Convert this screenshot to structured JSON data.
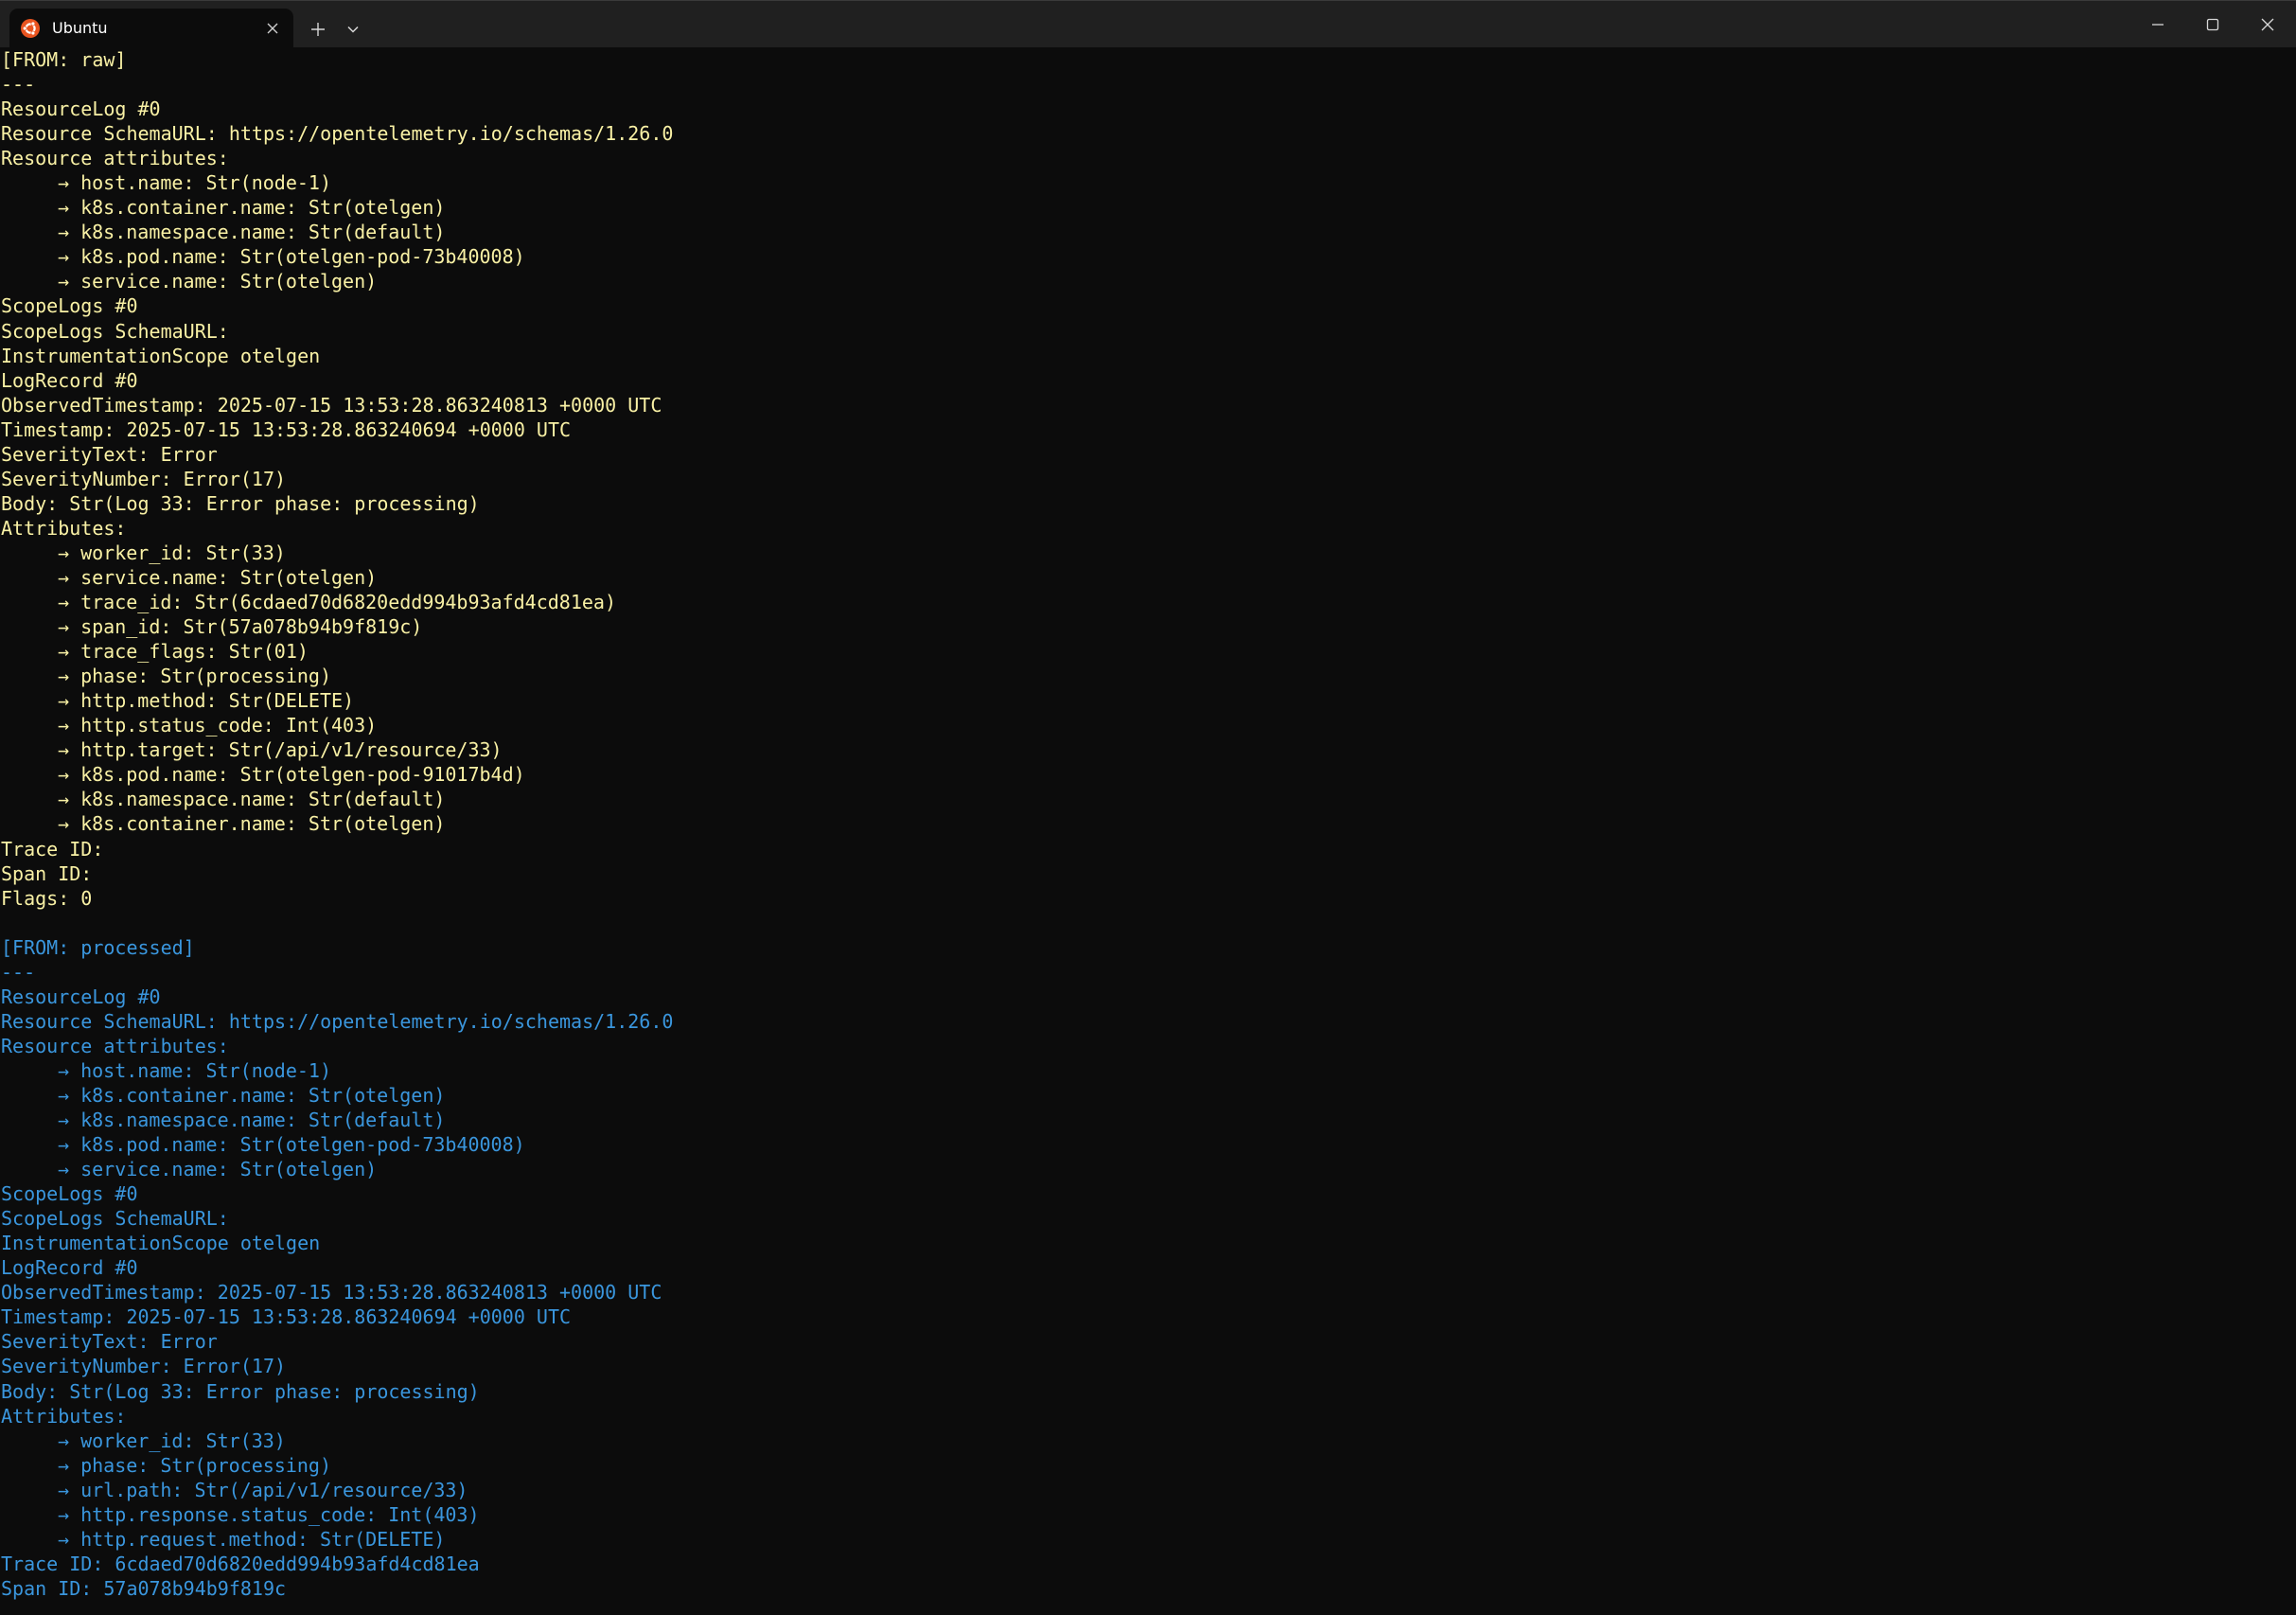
{
  "window": {
    "tab_title": "Ubuntu",
    "tab_icon": "ubuntu-logo-icon",
    "icons": {
      "close_tab": "close-icon",
      "new_tab": "plus-icon",
      "dropdown": "chevron-down-icon",
      "minimize": "minimize-icon",
      "maximize": "maximize-icon",
      "close": "close-icon"
    },
    "colors": {
      "raw_text": "#f9f1a5",
      "processed_text": "#3a96dd",
      "background": "#0c0c0c",
      "titlebar": "#202020",
      "ubuntu_orange": "#e95420"
    }
  },
  "raw": {
    "header": "[FROM: raw]",
    "separator": "---",
    "resource_log": "ResourceLog #0",
    "schema_url": "Resource SchemaURL: https://opentelemetry.io/schemas/1.26.0",
    "resource_attrs_label": "Resource attributes:",
    "resource_attrs": [
      "→ host.name: Str(node-1)",
      "→ k8s.container.name: Str(otelgen)",
      "→ k8s.namespace.name: Str(default)",
      "→ k8s.pod.name: Str(otelgen-pod-73b40008)",
      "→ service.name: Str(otelgen)"
    ],
    "scope_logs": "ScopeLogs #0",
    "scope_schema": "ScopeLogs SchemaURL:",
    "instrumentation_scope": "InstrumentationScope otelgen",
    "log_record": "LogRecord #0",
    "observed_timestamp": "ObservedTimestamp: 2025-07-15 13:53:28.863240813 +0000 UTC",
    "timestamp": "Timestamp: 2025-07-15 13:53:28.863240694 +0000 UTC",
    "severity_text": "SeverityText: Error",
    "severity_number": "SeverityNumber: Error(17)",
    "body": "Body: Str(Log 33: Error phase: processing)",
    "attributes_label": "Attributes:",
    "attributes": [
      "→ worker_id: Str(33)",
      "→ service.name: Str(otelgen)",
      "→ trace_id: Str(6cdaed70d6820edd994b93afd4cd81ea)",
      "→ span_id: Str(57a078b94b9f819c)",
      "→ trace_flags: Str(01)",
      "→ phase: Str(processing)",
      "→ http.method: Str(DELETE)",
      "→ http.status_code: Int(403)",
      "→ http.target: Str(/api/v1/resource/33)",
      "→ k8s.pod.name: Str(otelgen-pod-91017b4d)",
      "→ k8s.namespace.name: Str(default)",
      "→ k8s.container.name: Str(otelgen)"
    ],
    "trace_id": "Trace ID:",
    "span_id": "Span ID:",
    "flags": "Flags: 0"
  },
  "processed": {
    "header": "[FROM: processed]",
    "separator": "---",
    "resource_log": "ResourceLog #0",
    "schema_url": "Resource SchemaURL: https://opentelemetry.io/schemas/1.26.0",
    "resource_attrs_label": "Resource attributes:",
    "resource_attrs": [
      "→ host.name: Str(node-1)",
      "→ k8s.container.name: Str(otelgen)",
      "→ k8s.namespace.name: Str(default)",
      "→ k8s.pod.name: Str(otelgen-pod-73b40008)",
      "→ service.name: Str(otelgen)"
    ],
    "scope_logs": "ScopeLogs #0",
    "scope_schema": "ScopeLogs SchemaURL:",
    "instrumentation_scope": "InstrumentationScope otelgen",
    "log_record": "LogRecord #0",
    "observed_timestamp": "ObservedTimestamp: 2025-07-15 13:53:28.863240813 +0000 UTC",
    "timestamp": "Timestamp: 2025-07-15 13:53:28.863240694 +0000 UTC",
    "severity_text": "SeverityText: Error",
    "severity_number": "SeverityNumber: Error(17)",
    "body": "Body: Str(Log 33: Error phase: processing)",
    "attributes_label": "Attributes:",
    "attributes": [
      "→ worker_id: Str(33)",
      "→ phase: Str(processing)",
      "→ url.path: Str(/api/v1/resource/33)",
      "→ http.response.status_code: Int(403)",
      "→ http.request.method: Str(DELETE)"
    ],
    "trace_id": "Trace ID: 6cdaed70d6820edd994b93afd4cd81ea",
    "span_id": "Span ID: 57a078b94b9f819c"
  }
}
